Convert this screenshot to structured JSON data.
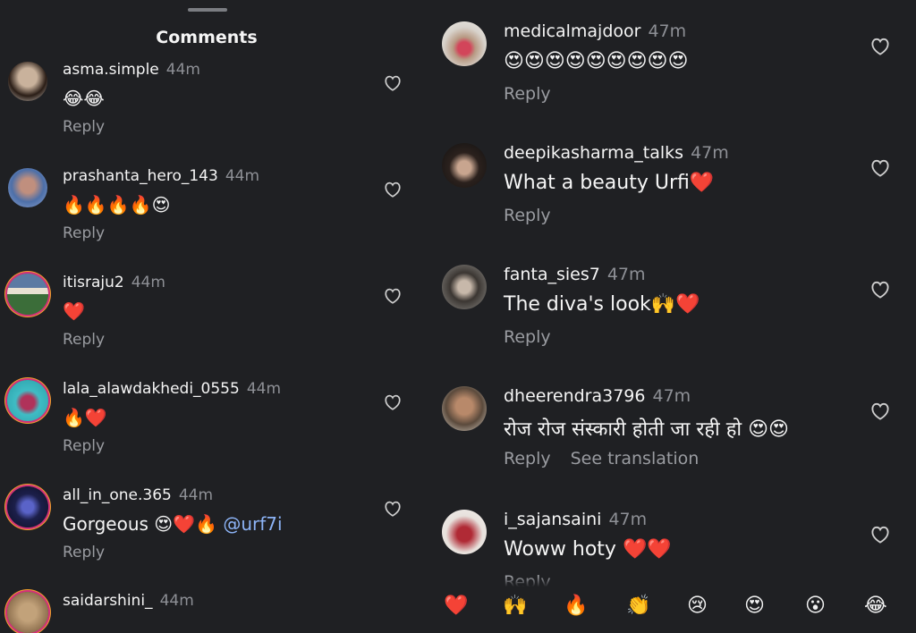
{
  "sheet": {
    "title": "Comments"
  },
  "reply_label": "Reply",
  "see_translation_label": "See translation",
  "left_comments": [
    {
      "username": "asma.simple",
      "time": "44m",
      "text": "😂😂"
    },
    {
      "username": "prashanta_hero_143",
      "time": "44m",
      "text": "🔥🔥🔥🔥😍"
    },
    {
      "username": "itisraju2",
      "time": "44m",
      "text": "❤️"
    },
    {
      "username": "lala_alawdakhedi_0555",
      "time": "44m",
      "text": "🔥❤️"
    },
    {
      "username": "all_in_one.365",
      "time": "44m",
      "text": "Gorgeous 😍❤️🔥 ",
      "mention": "@urf7i"
    },
    {
      "username": "saidarshini_",
      "time": "44m"
    }
  ],
  "right_comments": [
    {
      "username": "medicalmajdoor",
      "time": "47m",
      "text": "😍😍😍😍😍😍😍😍😍"
    },
    {
      "username": "deepikasharma_talks",
      "time": "47m",
      "text": "What a beauty Urfi❤️"
    },
    {
      "username": "fanta_sies7",
      "time": "47m",
      "text": "The diva's look🙌❤️"
    },
    {
      "username": "dheerendra3796",
      "time": "47m",
      "text": "रोज रोज संस्कारी होती जा रही हो 😍😍"
    },
    {
      "username": "i_sajansaini",
      "time": "47m",
      "text": "Woww hoty ❤️❤️"
    }
  ],
  "quick_reactions": [
    "❤️",
    "🙌",
    "🔥",
    "👏",
    "😢",
    "😍",
    "😮",
    "😂"
  ],
  "icons": {
    "like": "heart-outline-icon"
  },
  "colors": {
    "background": "#1f2023",
    "mention": "#8db4f7",
    "muted": "#8e9096"
  }
}
